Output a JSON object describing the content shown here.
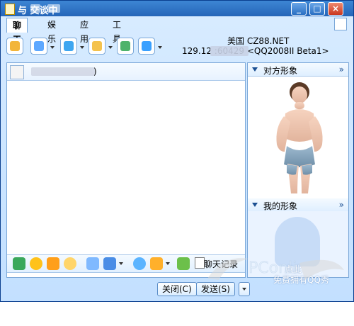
{
  "window": {
    "title": "与 交谈中"
  },
  "tabs": [
    {
      "label": "聊天"
    },
    {
      "label": "娱乐"
    },
    {
      "label": "应用"
    },
    {
      "label": "工具"
    }
  ],
  "peer_info": {
    "location": "美国  CZ88.NET",
    "ip_line": "129.12        :60429 <QQ2008II Beta1>"
  },
  "chat": {
    "peer_name_suffix": ")"
  },
  "format_bar": {
    "history_label": "聊天记录"
  },
  "buttons": {
    "close_label": "关闭(C)",
    "send_label": "发送(S)"
  },
  "right_panel": {
    "peer_avatar_title": "对方形象",
    "my_avatar_title": "我的形象",
    "my_avatar_hint_1": "点此",
    "my_avatar_hint_2": "免费拥有QQ秀"
  },
  "watermark": {
    "text": "PConline"
  }
}
